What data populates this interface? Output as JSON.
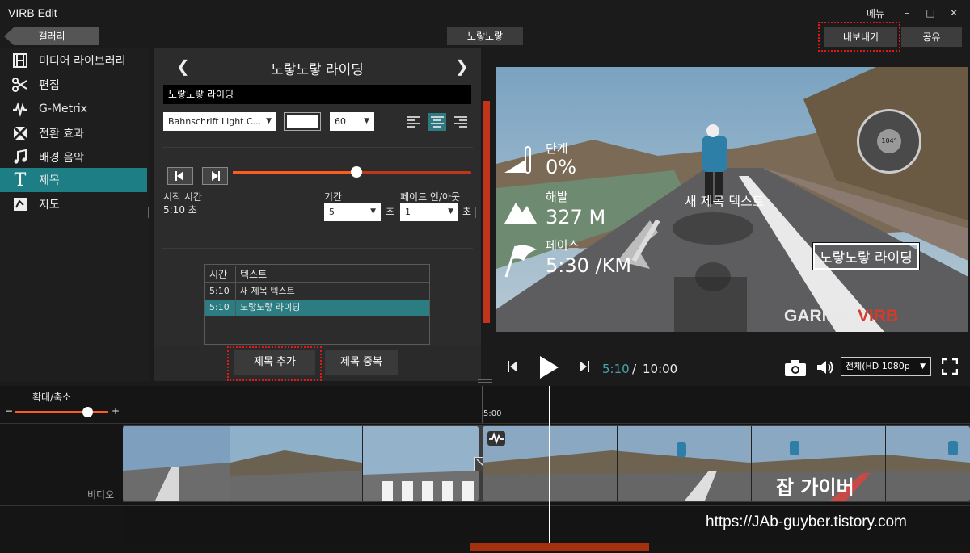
{
  "app": {
    "title": "VIRB Edit",
    "menu_label": "메뉴"
  },
  "nav": {
    "gallery_label": "갤러리",
    "project_name": "노랗노랗",
    "export_label": "내보내기",
    "share_label": "공유"
  },
  "sidebar": {
    "items": [
      {
        "label": "미디어 라이브러리",
        "icon": "film-icon"
      },
      {
        "label": "편집",
        "icon": "scissors-icon"
      },
      {
        "label": "G-Metrix",
        "icon": "g-metrix-icon"
      },
      {
        "label": "전환 효과",
        "icon": "transition-icon"
      },
      {
        "label": "배경 음악",
        "icon": "music-note-icon"
      },
      {
        "label": "제목",
        "icon": "title-t-icon",
        "active": true
      },
      {
        "label": "지도",
        "icon": "map-icon"
      }
    ]
  },
  "title_editor": {
    "header": "노랗노랗 라이딩",
    "text_value": "노랗노랗 라이딩",
    "font": "Bahnschrift Light C...",
    "font_size": "60",
    "text_color": "#ffffff",
    "start_label": "시작 시간",
    "start_value": "5:10 초",
    "duration_label": "기간",
    "duration_value": "5",
    "duration_unit": "초",
    "fade_label": "페이드 인/아웃",
    "fade_value": "1",
    "fade_unit": "초",
    "position_fraction": 0.52,
    "table": {
      "col_time": "시간",
      "col_text": "텍스트",
      "rows": [
        {
          "time": "5:10",
          "text": "새 제목 텍스트"
        },
        {
          "time": "5:10",
          "text": "노랗노랗 라이딩",
          "selected": true
        }
      ]
    },
    "add_title_label": "제목 추가",
    "duplicate_title_label": "제목 중복"
  },
  "preview": {
    "overlay_title": "노랗노랗 라이딩",
    "overlay_new_text": "새 제목 텍스트",
    "gauges": [
      {
        "label": "단계",
        "value": "0%",
        "icon": "thermometer-icon"
      },
      {
        "label": "해발",
        "value": "327 M",
        "icon": "mountain-icon"
      },
      {
        "label": "페이스",
        "value": "5:30 /KM",
        "icon": "flag-icon"
      }
    ],
    "compass_value": "104°",
    "brand": "GARMIN.",
    "brand2": "VIRB"
  },
  "playback": {
    "current_time": "5:10",
    "separator": "/",
    "total_time": "10:00",
    "quality": "전체(HD 1080p"
  },
  "timeline": {
    "zoom_label": "확대/축소",
    "zoom_minus": "−",
    "zoom_plus": "+",
    "zoom_fraction": 0.78,
    "ruler_mark": "5:00",
    "track_label": "비디오"
  },
  "watermark": {
    "name": "잡 가이버",
    "url": "https://JAb-guyber.tistory.com"
  },
  "colors": {
    "accent_teal": "#1d7f85",
    "accent_orange": "#ff5a1f",
    "highlight_dash": "#e21818"
  }
}
